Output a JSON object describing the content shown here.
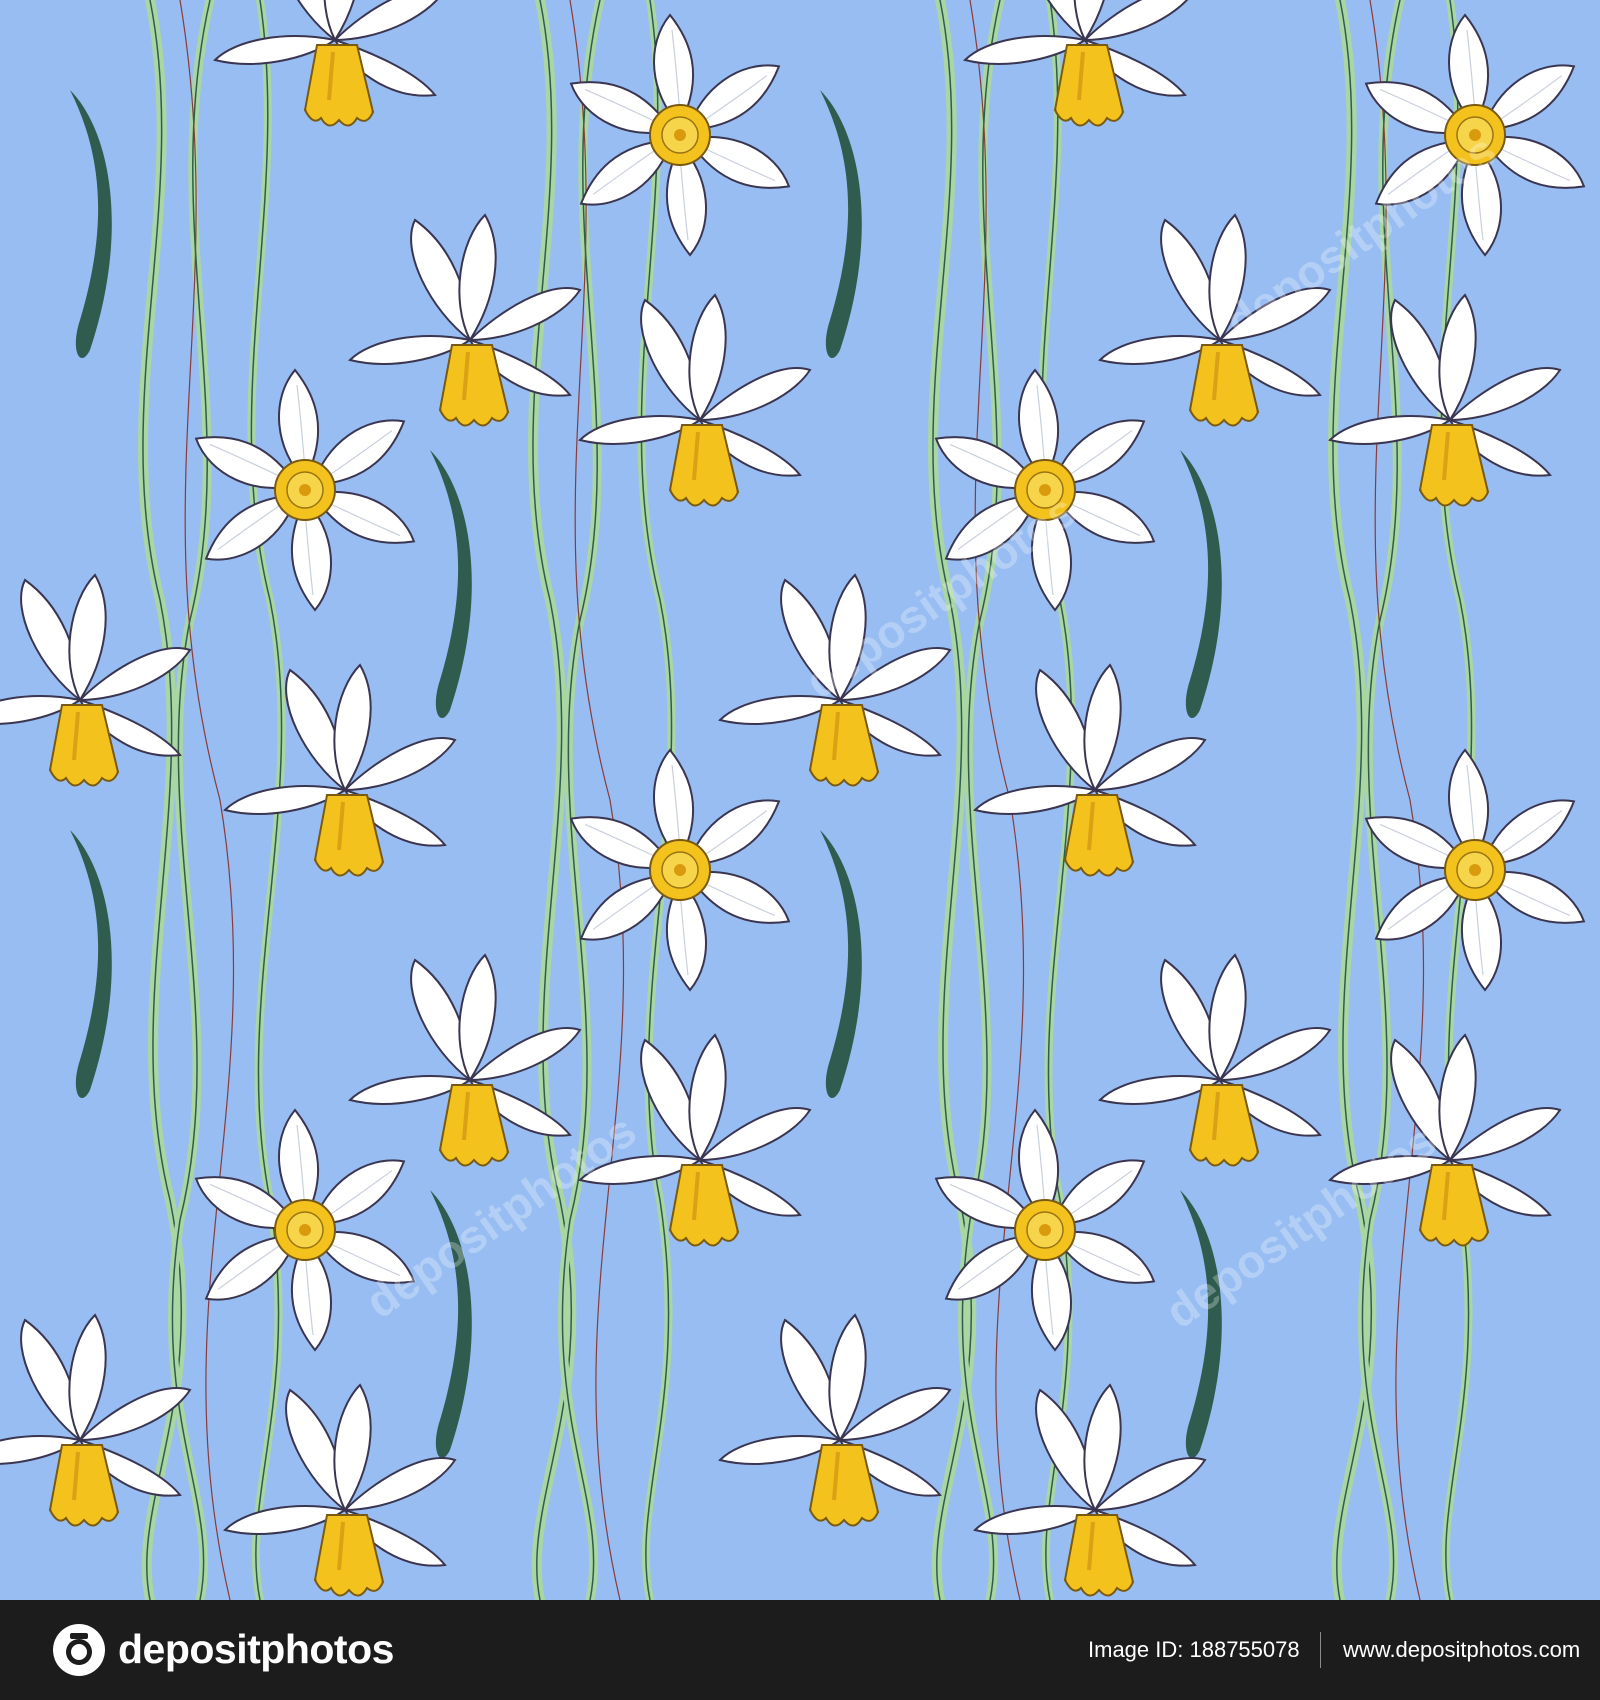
{
  "artwork": {
    "subject": "seamless pattern of white narcissus (daffodil) flowers with green leaves",
    "colors": {
      "background": "#98bdf2",
      "petal": "#ffffff",
      "petal_outline": "#3a3550",
      "corona": "#f3c21c",
      "leaf_light": "#a9d6a2",
      "leaf_dark": "#2f5c4e",
      "watermark": "#ffffff"
    },
    "watermark_text": "depositphotos"
  },
  "footer": {
    "logo_icon": "camera-icon",
    "logo_text": "depositphotos",
    "image_id": "Image ID: 188755078",
    "site": "www.depositphotos.com"
  }
}
